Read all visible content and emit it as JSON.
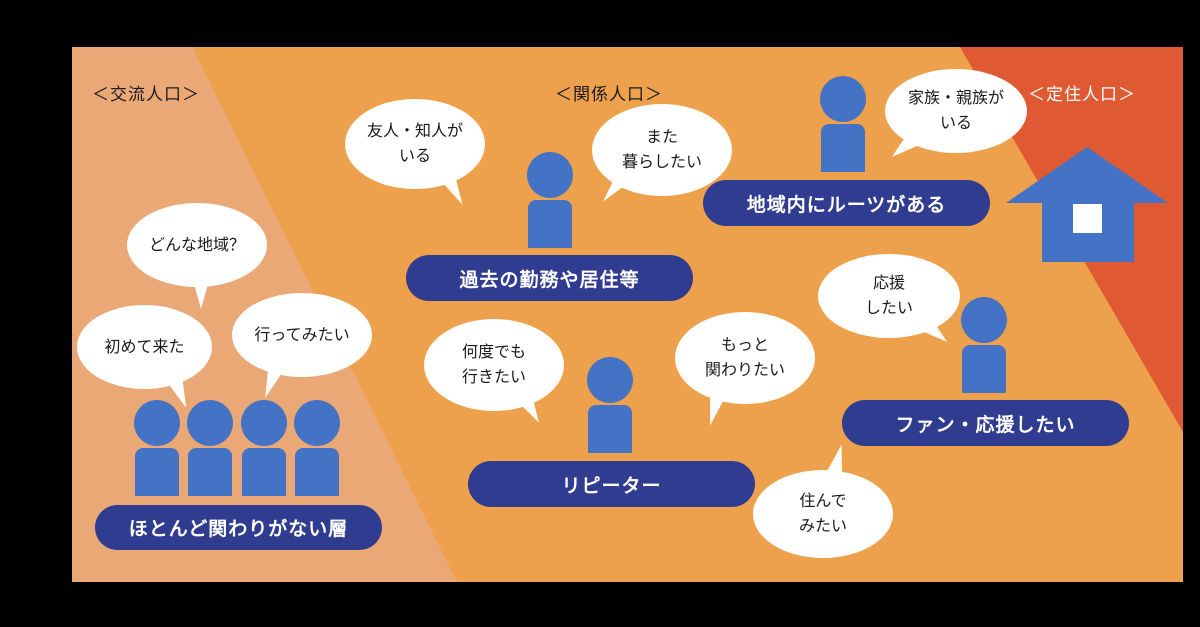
{
  "zones": {
    "exchange": "＜交流人口＞",
    "related": "＜関係人口＞",
    "resident": "＜定住人口＞"
  },
  "bubbles": {
    "friend": "友人・知人が\nいる",
    "again": "また\n暮らしたい",
    "family": "家族・親族が\nいる",
    "which_area": "どんな地域？",
    "first_time": "初めて来た",
    "want_to_go": "行ってみたい",
    "many_times": "何度でも\n行きたい",
    "more_involved": "もっと\n関わりたい",
    "support": "応援\nしたい",
    "live": "住んで\nみたい"
  },
  "labels": {
    "no_relation": "ほとんど関わりがない層",
    "past": "過去の勤務や居住等",
    "roots": "地域内にルーツがある",
    "repeater": "リピーター",
    "fan": "ファン・応援したい"
  },
  "colors": {
    "exchange_zone": "#eba877",
    "related_zone": "#eda14d",
    "resident_zone": "#df5a33",
    "person": "#4472c4",
    "house": "#4472c4",
    "label_bg": "#2f3c8f"
  },
  "icons": [
    "person-icon",
    "house-icon"
  ]
}
